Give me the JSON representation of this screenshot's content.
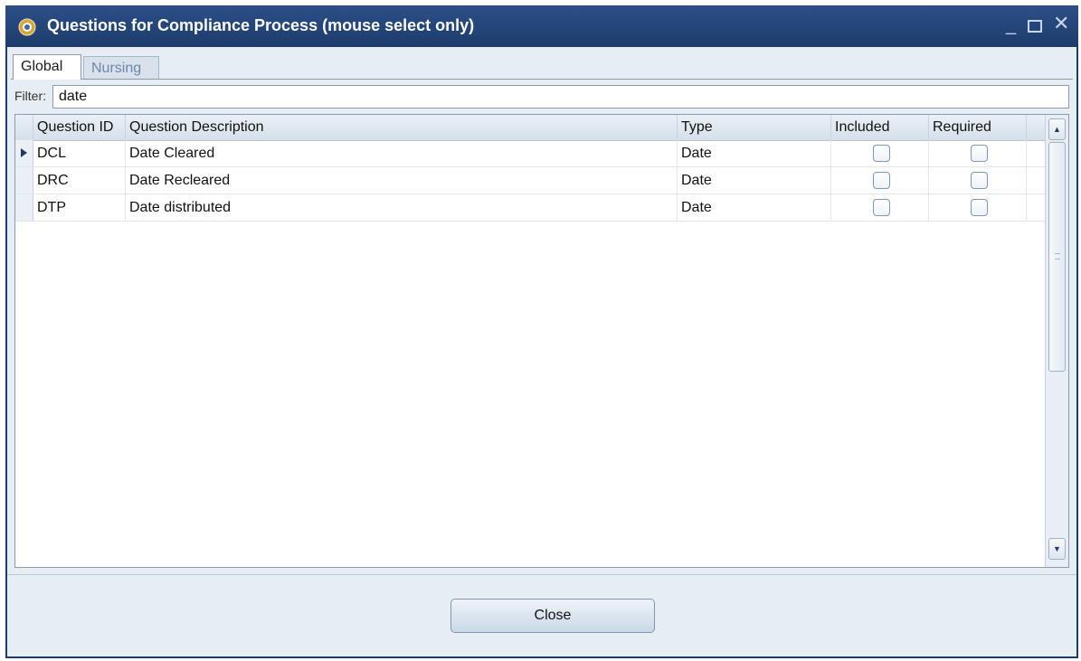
{
  "window": {
    "title": "Questions for Compliance Process (mouse select only)",
    "icon": "gear-globe-icon",
    "controls": {
      "minimize": "_",
      "maximize": "maximize-icon",
      "close": "✕"
    }
  },
  "tabs": [
    {
      "label": "Global",
      "active": true
    },
    {
      "label": "Nursing",
      "active": false
    }
  ],
  "filter": {
    "label": "Filter:",
    "value": "date"
  },
  "grid": {
    "columns": {
      "id": "Question ID",
      "description": "Question Description",
      "type": "Type",
      "included": "Included",
      "required": "Required"
    },
    "rows": [
      {
        "id": "DCL",
        "description": "Date Cleared",
        "type": "Date",
        "included": false,
        "required": false,
        "current": true
      },
      {
        "id": "DRC",
        "description": "Date Recleared",
        "type": "Date",
        "included": false,
        "required": false,
        "current": false
      },
      {
        "id": "DTP",
        "description": "Date distributed",
        "type": "Date",
        "included": false,
        "required": false,
        "current": false
      }
    ]
  },
  "footer": {
    "close_label": "Close"
  },
  "colors": {
    "titlebar": "#1e3a66",
    "client_bg": "#e6edf3",
    "accent": "#1e3a66"
  }
}
